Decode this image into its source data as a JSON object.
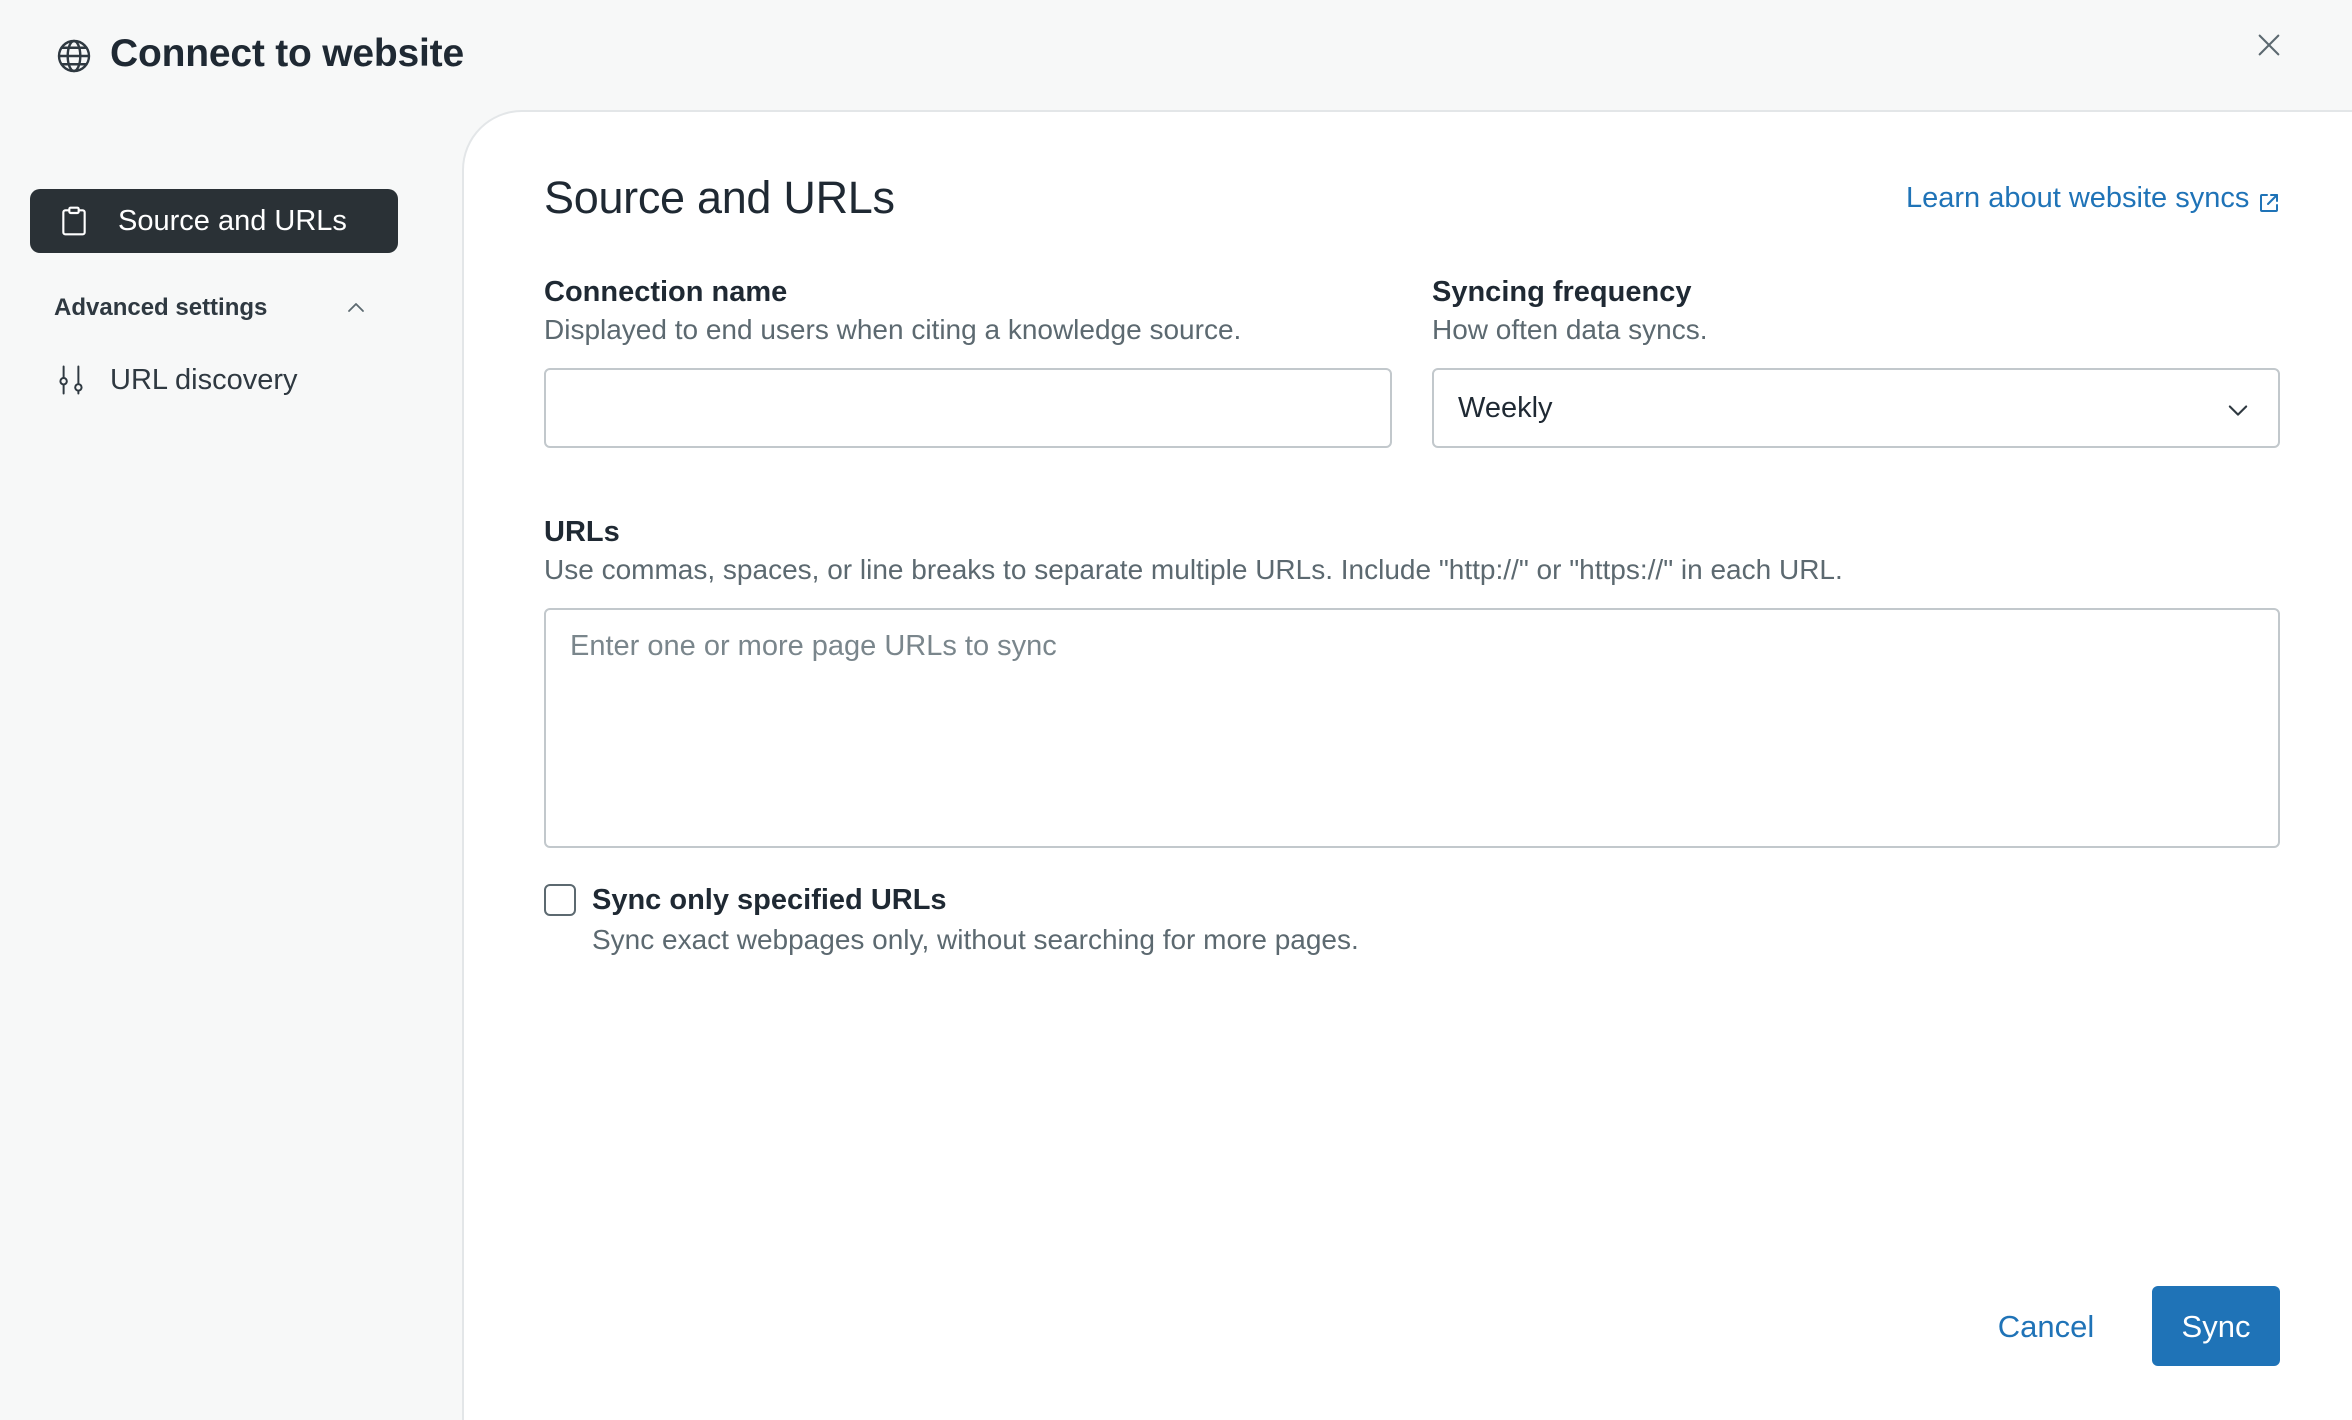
{
  "header": {
    "title": "Connect to website",
    "icon": "globe-icon"
  },
  "sidebar": {
    "items": [
      {
        "label": "Source and URLs",
        "icon": "clipboard-icon",
        "active": true
      }
    ],
    "advanced": {
      "label": "Advanced settings",
      "expanded": true,
      "items": [
        {
          "label": "URL discovery",
          "icon": "sliders-icon"
        }
      ]
    }
  },
  "content": {
    "title": "Source and URLs",
    "learn_link": "Learn about website syncs",
    "connection_name": {
      "label": "Connection name",
      "hint": "Displayed to end users when citing a knowledge source.",
      "value": ""
    },
    "syncing_frequency": {
      "label": "Syncing frequency",
      "hint": "How often data syncs.",
      "value": "Weekly"
    },
    "urls": {
      "label": "URLs",
      "hint": "Use commas, spaces, or line breaks to separate multiple URLs. Include \"http://\" or \"https://\" in each URL.",
      "placeholder": "Enter one or more page URLs to sync"
    },
    "sync_only": {
      "label": "Sync only specified URLs",
      "hint": "Sync exact webpages only, without searching for more pages.",
      "checked": false
    }
  },
  "footer": {
    "cancel_label": "Cancel",
    "sync_label": "Sync"
  },
  "colors": {
    "accent": "#1f73b7",
    "active_nav_bg": "#2a3136",
    "background": "#f7f8f8"
  }
}
